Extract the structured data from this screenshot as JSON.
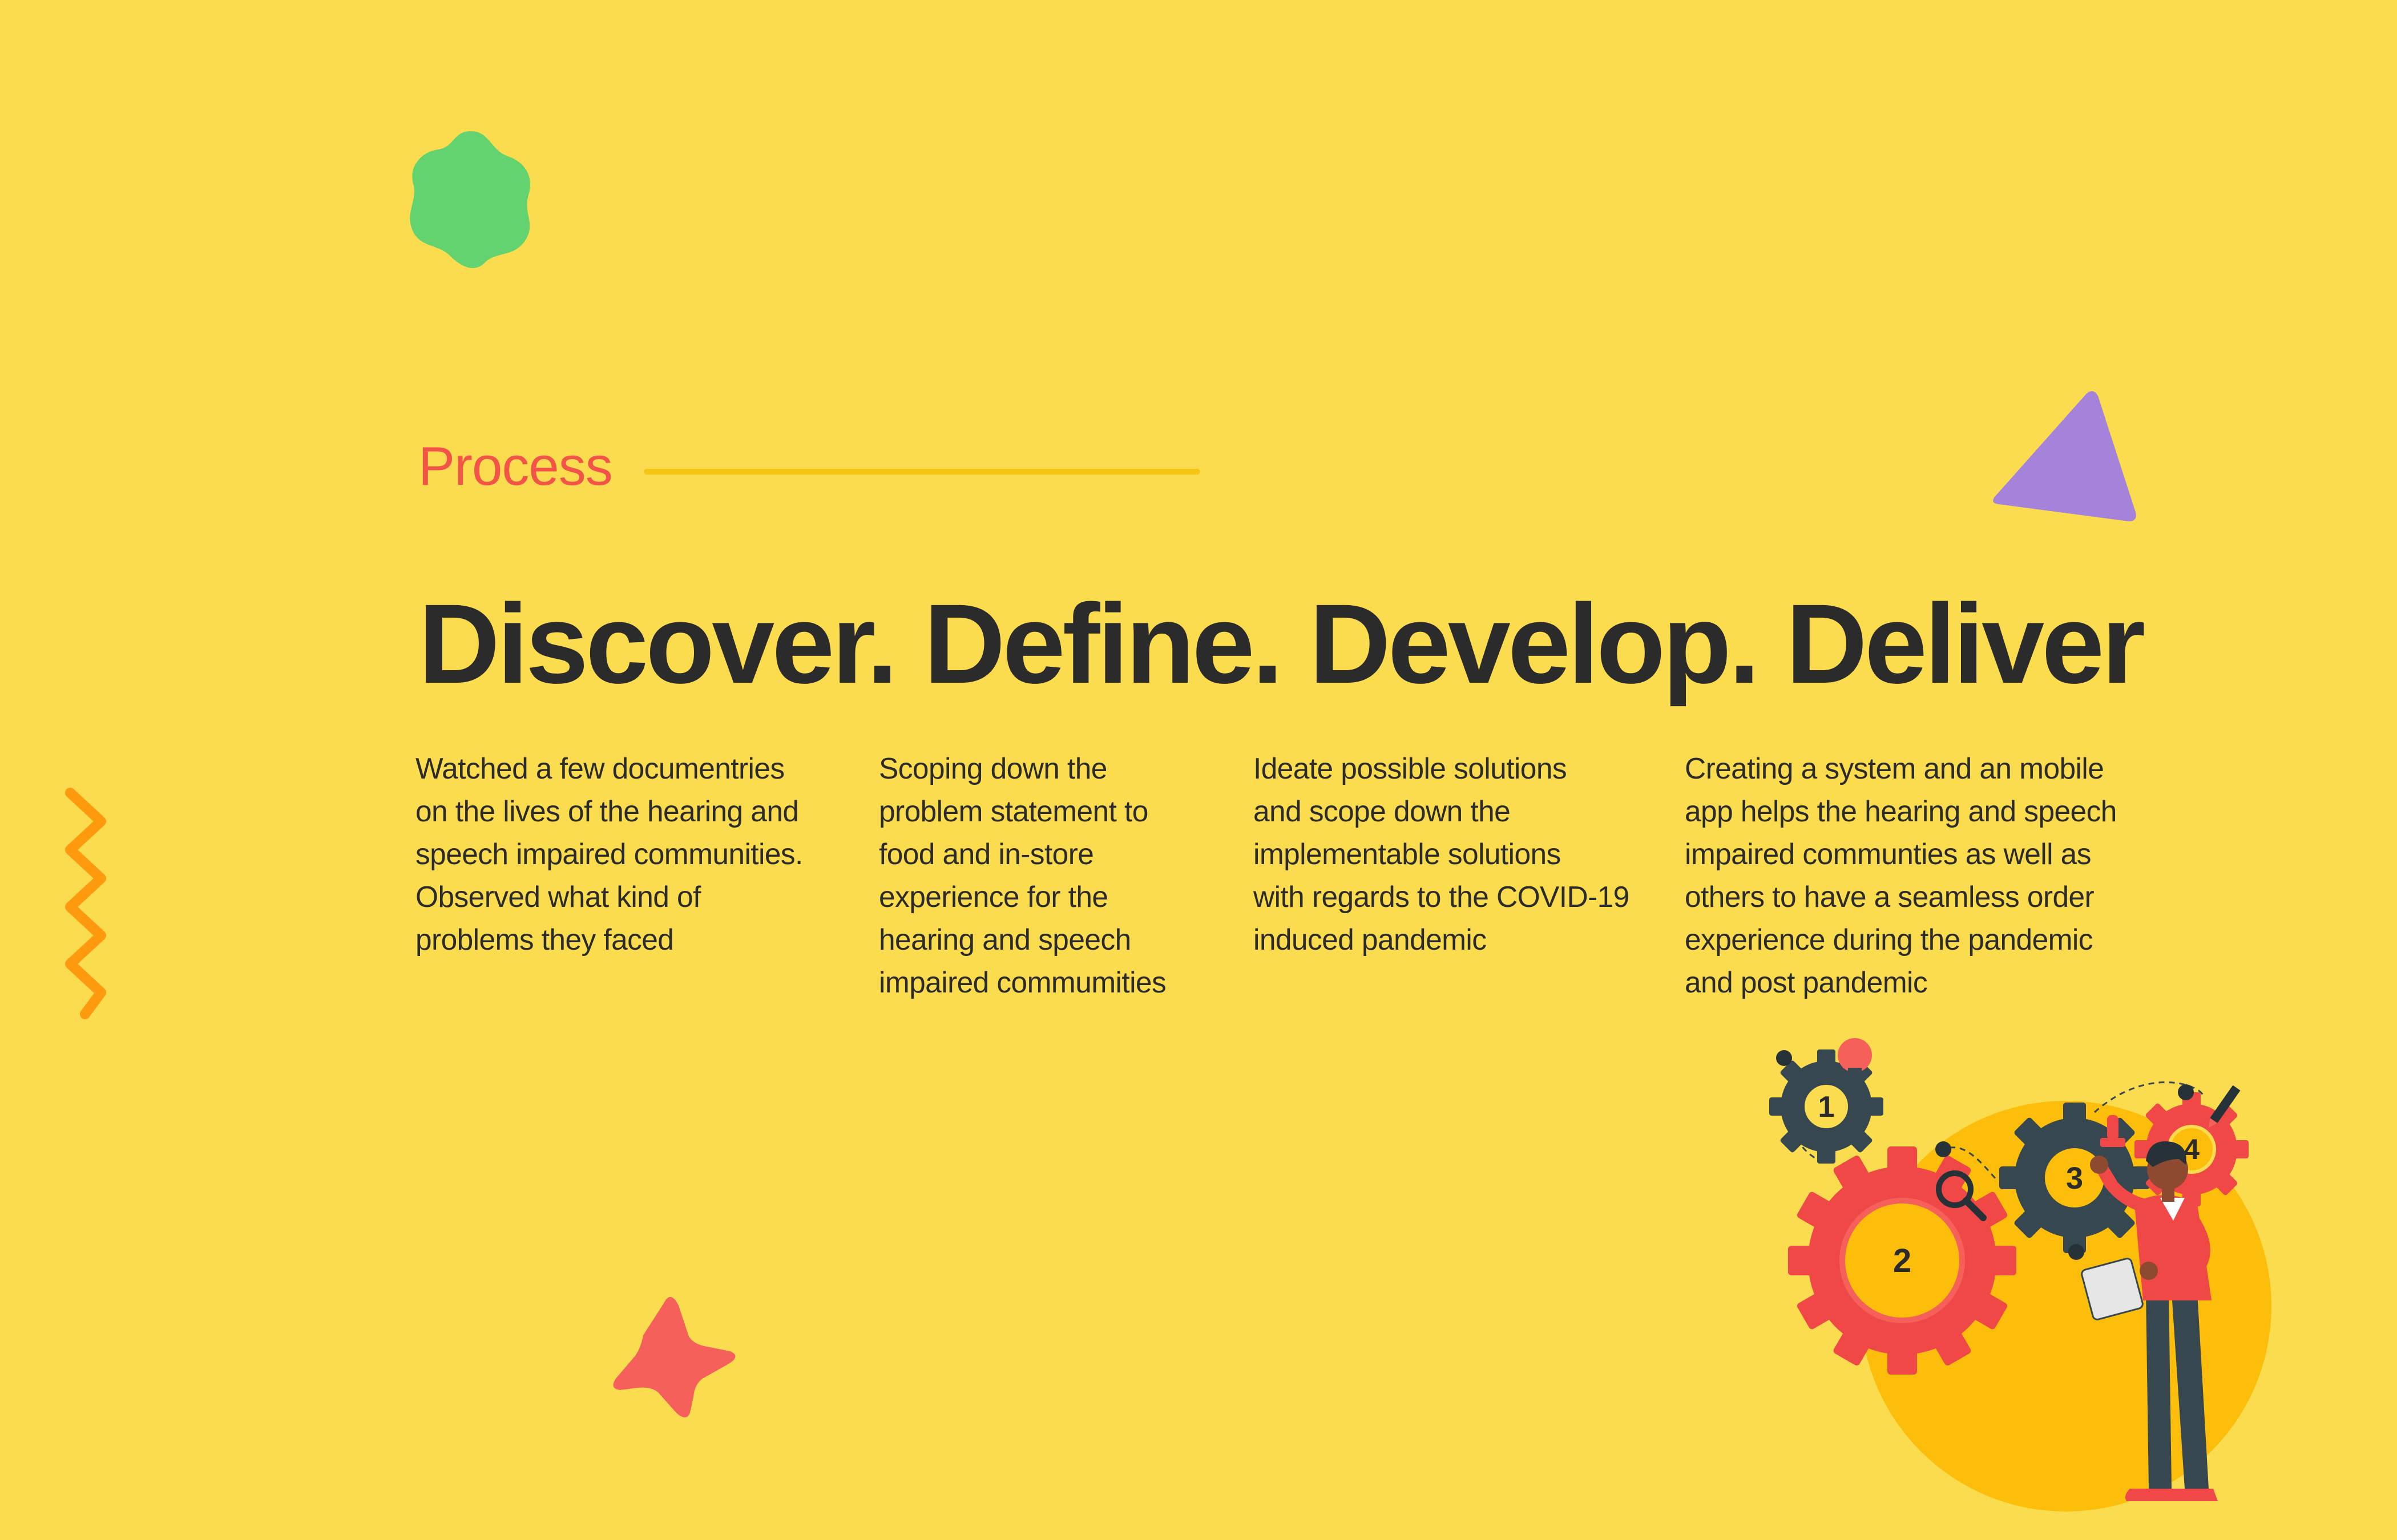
{
  "section": {
    "eyebrow": "Process",
    "headline": "Discover. Define. Develop. Deliver"
  },
  "steps": [
    {
      "name": "discover",
      "text": "Watched a few documentries\non the lives of the hearing and\nspeech impaired communities.\nObserved what kind of\nproblems they faced"
    },
    {
      "name": "define",
      "text": "Scoping down the\nproblem statement to\nfood and in-store\nexperience for the\nhearing and speech\nimpaired commumities"
    },
    {
      "name": "develop",
      "text": "Ideate possible solutions\nand scope down the\nimplementable solutions\nwith regards to the COVID-19\ninduced pandemic"
    },
    {
      "name": "deliver",
      "text": "Creating a system and an mobile\napp helps the hearing and speech\nimpaired communties as well as\nothers to have a seamless order\nexperience during the pandemic\nand post pandemic"
    }
  ],
  "illustration": {
    "gear_numbers": [
      "1",
      "2",
      "3",
      "4"
    ]
  },
  "colors": {
    "background": "#FCDC4F",
    "accent_red": "#F25548",
    "rule_yellow": "#F6C413",
    "text_dark": "#2B2B2B",
    "green": "#62D36E",
    "purple": "#A583DA",
    "orange": "#FF9A0E",
    "gear_gray": "#37474F",
    "circle_yellow": "#FCBE0A"
  }
}
